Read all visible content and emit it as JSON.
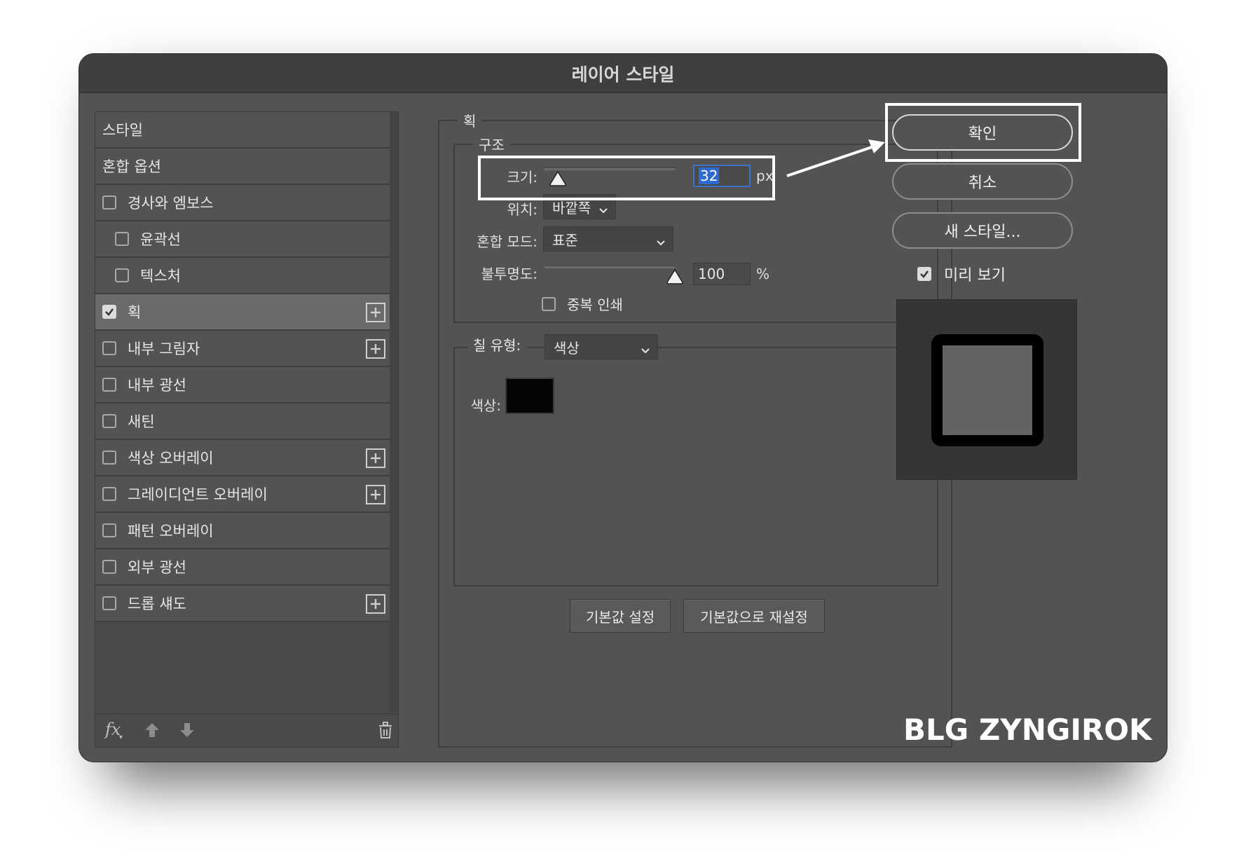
{
  "window": {
    "title": "레이어 스타일"
  },
  "styles_panel": {
    "header": "스타일",
    "blend_options": "혼합 옵션",
    "items": [
      {
        "label": "경사와 엠보스",
        "checked": false,
        "indent": false,
        "plus": false,
        "selected": false
      },
      {
        "label": "윤곽선",
        "checked": false,
        "indent": true,
        "plus": false,
        "selected": false
      },
      {
        "label": "텍스처",
        "checked": false,
        "indent": true,
        "plus": false,
        "selected": false
      },
      {
        "label": "획",
        "checked": true,
        "indent": false,
        "plus": true,
        "selected": true
      },
      {
        "label": "내부 그림자",
        "checked": false,
        "indent": false,
        "plus": true,
        "selected": false
      },
      {
        "label": "내부 광선",
        "checked": false,
        "indent": false,
        "plus": false,
        "selected": false
      },
      {
        "label": "새틴",
        "checked": false,
        "indent": false,
        "plus": false,
        "selected": false
      },
      {
        "label": "색상 오버레이",
        "checked": false,
        "indent": false,
        "plus": true,
        "selected": false
      },
      {
        "label": "그레이디언트 오버레이",
        "checked": false,
        "indent": false,
        "plus": true,
        "selected": false
      },
      {
        "label": "패턴 오버레이",
        "checked": false,
        "indent": false,
        "plus": false,
        "selected": false
      },
      {
        "label": "외부 광선",
        "checked": false,
        "indent": false,
        "plus": false,
        "selected": false
      },
      {
        "label": "드롭 섀도",
        "checked": false,
        "indent": false,
        "plus": true,
        "selected": false
      }
    ],
    "footer": {
      "fx_label": "fx"
    }
  },
  "stroke": {
    "section_title": "획",
    "structure": {
      "title": "구조",
      "size_label": "크기:",
      "size_value": "32",
      "size_unit": "px",
      "size_slider": 0.1,
      "position_label": "위치:",
      "position_value": "바깥쪽",
      "blend_label": "혼합 모드:",
      "blend_value": "표준",
      "opacity_label": "불투명도:",
      "opacity_value": "100",
      "opacity_unit": "%",
      "opacity_slider": 1.0,
      "overprint_label": "중복 인쇄",
      "overprint_checked": false
    },
    "fill": {
      "fill_type_label": "칠 유형:",
      "fill_type_value": "색상",
      "color_label": "색상:",
      "color_value": "#050505"
    },
    "set_default": "기본값 설정",
    "reset_default": "기본값으로 재설정"
  },
  "actions": {
    "ok": "확인",
    "cancel": "취소",
    "new_style": "새 스타일...",
    "preview_label": "미리 보기",
    "preview_checked": true
  },
  "watermark": "BLG ZYNGIROK",
  "colors": {
    "window_bg": "#535353",
    "titlebar_bg": "#3f3f3f",
    "selection_blue": "#2f6ad0",
    "highlight": "#ffffff"
  }
}
